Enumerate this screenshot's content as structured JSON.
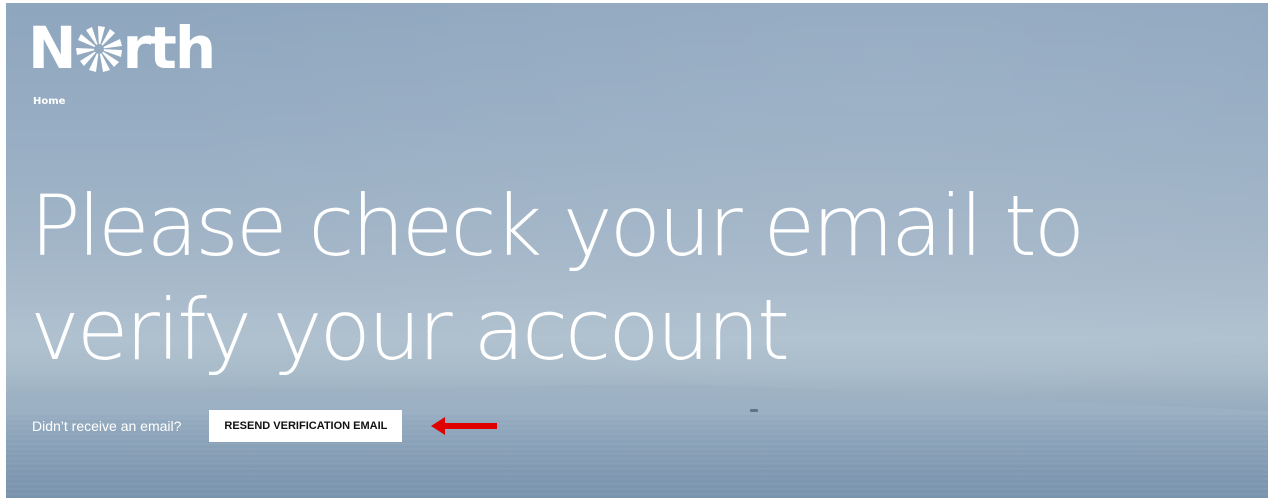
{
  "brand": {
    "logo_prefix": "N",
    "logo_suffix": "rth",
    "logo_alt": "North"
  },
  "breadcrumb": {
    "home_label": "Home"
  },
  "headline": {
    "text": "Please check your email to verify your account"
  },
  "resend": {
    "prompt": "Didn’t receive an email?",
    "button_label": "RESEND VERIFICATION EMAIL"
  },
  "annotation": {
    "arrow_color": "#e00000"
  },
  "colors": {
    "text": "#ffffff",
    "button_bg": "#ffffff",
    "button_text": "#111111"
  }
}
